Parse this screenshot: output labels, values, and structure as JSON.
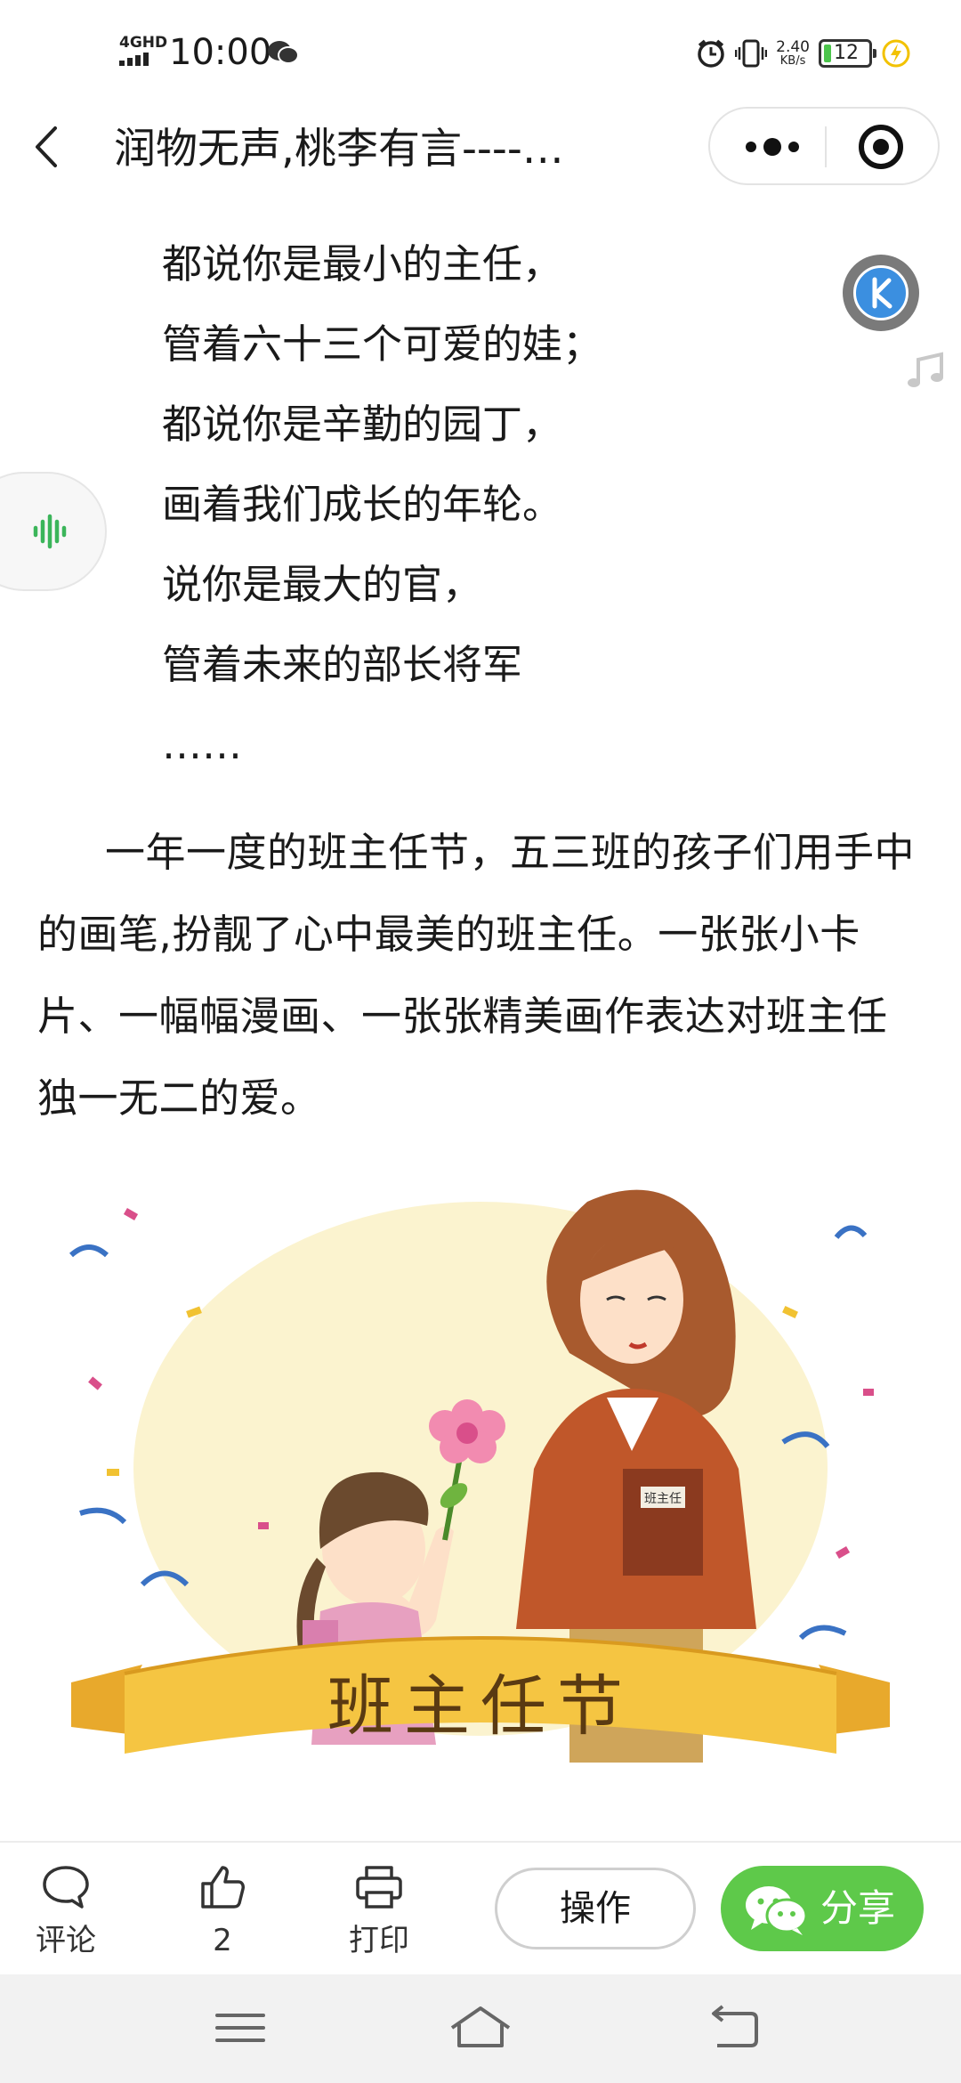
{
  "status_bar": {
    "network": "4GHD",
    "time": "10:00",
    "net_speed_value": "2.40",
    "net_speed_unit": "KB/s",
    "battery": "12"
  },
  "nav": {
    "title": "润物无声,桃李有言----…"
  },
  "article": {
    "poem_lines": [
      "都说你是最小的主任，",
      "管着六十三个可爱的娃；",
      "都说你是辛勤的园丁，",
      "画着我们成长的年轮。",
      "说你是最大的官，",
      "管着未来的部长将军",
      "……"
    ],
    "paragraph": "一年一度的班主任节，五三班的孩子们用手中的画笔,扮靓了心中最美的班主任。一张张小卡片、一幅幅漫画、一张张精美画作表达对班主任独一无二的爱。",
    "illustration": {
      "banner_text": "班主任节",
      "book_label": "班主任"
    }
  },
  "actions": {
    "comment_label": "评论",
    "like_count": "2",
    "print_label": "打印",
    "operate_label": "操作",
    "share_label": "分享"
  },
  "colors": {
    "share_green": "#5ec94a",
    "voice_green": "#3bb55a",
    "k_badge_blue": "#3b8fe0"
  },
  "icons": [
    "back-icon",
    "more-icon",
    "close-target-icon",
    "k-icon",
    "music-note-icon",
    "voice-wave-icon",
    "comment-icon",
    "thumbs-up-icon",
    "printer-icon",
    "wechat-icon",
    "menu-icon",
    "home-icon",
    "back-nav-icon"
  ]
}
